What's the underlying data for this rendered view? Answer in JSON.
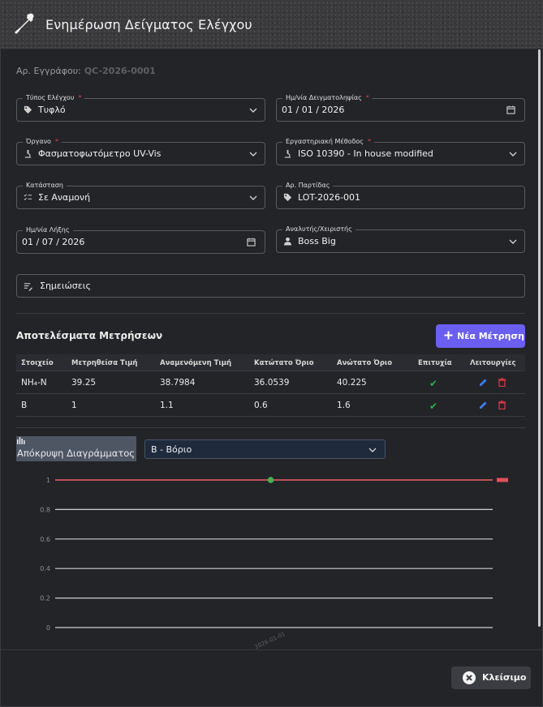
{
  "header": {
    "title": "Ενημέρωση Δείγματος Ελέγχου"
  },
  "doc": {
    "label": "Αρ. Εγγράφου:",
    "number": "QC-2026-0001"
  },
  "form": {
    "type": {
      "label": "Τύπος Ελέγχου",
      "value": "Τυφλό"
    },
    "sampling_date": {
      "label": "Ημ/νία Δειγματοληψίας",
      "value": "01 / 01 / 2026"
    },
    "instrument": {
      "label": "Όργανο",
      "value": "Φασματοφωτόμετρο UV-Vis"
    },
    "method": {
      "label": "Εργαστηριακή Μέθοδος",
      "value": "ISO 10390 - In house modified"
    },
    "status": {
      "label": "Κατάσταση",
      "value": "Σε Αναμονή"
    },
    "batch": {
      "label": "Αρ. Παρτίδας",
      "value": "LOT-2026-001"
    },
    "expiry_date": {
      "label": "Ημ/νία Λήξης",
      "value": "01 / 07 / 2026"
    },
    "analyst": {
      "label": "Αναλυτής/Χειριστής",
      "value": "Boss Big"
    },
    "notes": {
      "label": "Σημειώσεις"
    },
    "required_mark": "*"
  },
  "results": {
    "title": "Αποτελέσματα Μετρήσεων",
    "new_button": "Νέα Μέτρηση",
    "columns": [
      "Στοιχείο",
      "Μετρηθείσα Τιμή",
      "Αναμενόμενη Τιμή",
      "Κατώτατο Όριο",
      "Ανώτατο Όριο",
      "Επιτυχία",
      "Λειτουργίες"
    ],
    "rows": [
      {
        "element": "NH₄-N",
        "measured": "39.25",
        "expected": "38.7984",
        "lower": "36.0539",
        "upper": "40.225",
        "success": "✔"
      },
      {
        "element": "B",
        "measured": "1",
        "expected": "1.1",
        "lower": "0.6",
        "upper": "1.6",
        "success": "✔"
      }
    ]
  },
  "chart_controls": {
    "hide_button": "Απόκρυψη Διαγράμματος",
    "selected_element": "B - Βόριο"
  },
  "chart_data": {
    "type": "line",
    "x": [
      "2026-01-01"
    ],
    "yticks": [
      0,
      0.2,
      0.4,
      0.6,
      0.8,
      1
    ],
    "ylim": [
      0,
      1
    ],
    "series": [
      {
        "values": [
          1
        ]
      }
    ],
    "limit_line": 1,
    "colors": {
      "series": "#4caf50",
      "limit": "#e0505a",
      "grid": "#cfcfcf"
    }
  },
  "footer": {
    "close_button": "Κλείσιμο"
  }
}
